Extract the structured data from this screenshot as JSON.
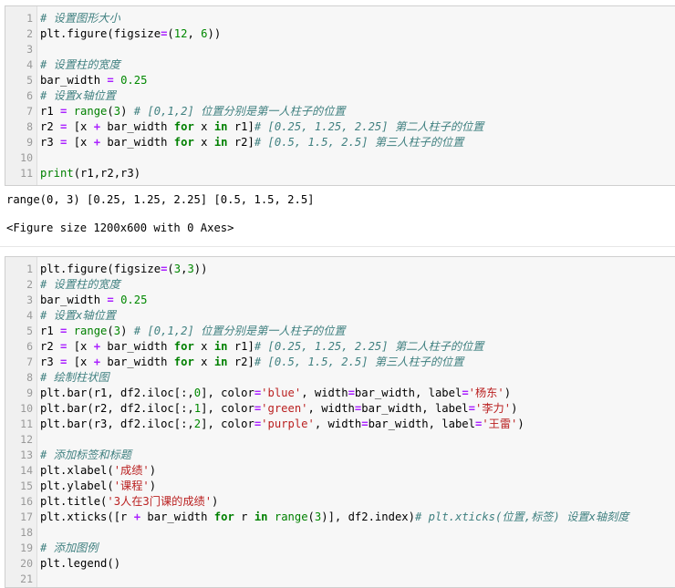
{
  "cell1": {
    "lines": [
      {
        "n": "1",
        "tokens": [
          {
            "t": "# 设置图形大小",
            "c": "cm"
          }
        ]
      },
      {
        "n": "2",
        "tokens": [
          {
            "t": "plt.figure(figsize"
          },
          {
            "t": "=",
            "c": "op"
          },
          {
            "t": "("
          },
          {
            "t": "12",
            "c": "nm"
          },
          {
            "t": ", "
          },
          {
            "t": "6",
            "c": "nm"
          },
          {
            "t": "))"
          }
        ]
      },
      {
        "n": "3",
        "tokens": []
      },
      {
        "n": "4",
        "tokens": [
          {
            "t": "# 设置柱的宽度",
            "c": "cm"
          }
        ]
      },
      {
        "n": "5",
        "tokens": [
          {
            "t": "bar_width "
          },
          {
            "t": "=",
            "c": "op"
          },
          {
            "t": " "
          },
          {
            "t": "0.25",
            "c": "nm"
          }
        ]
      },
      {
        "n": "6",
        "tokens": [
          {
            "t": "# 设置x轴位置",
            "c": "cm"
          }
        ]
      },
      {
        "n": "7",
        "tokens": [
          {
            "t": "r1 "
          },
          {
            "t": "=",
            "c": "op"
          },
          {
            "t": " "
          },
          {
            "t": "range",
            "c": "bi"
          },
          {
            "t": "("
          },
          {
            "t": "3",
            "c": "nm"
          },
          {
            "t": ") "
          },
          {
            "t": "# [0,1,2] 位置分别是第一人柱子的位置",
            "c": "cm"
          }
        ]
      },
      {
        "n": "8",
        "tokens": [
          {
            "t": "r2 "
          },
          {
            "t": "=",
            "c": "op"
          },
          {
            "t": " [x "
          },
          {
            "t": "+",
            "c": "op"
          },
          {
            "t": " bar_width "
          },
          {
            "t": "for",
            "c": "kw"
          },
          {
            "t": " x "
          },
          {
            "t": "in",
            "c": "kw"
          },
          {
            "t": " r1]"
          },
          {
            "t": "# [0.25, 1.25, 2.25] 第二人柱子的位置",
            "c": "cm"
          }
        ]
      },
      {
        "n": "9",
        "tokens": [
          {
            "t": "r3 "
          },
          {
            "t": "=",
            "c": "op"
          },
          {
            "t": " [x "
          },
          {
            "t": "+",
            "c": "op"
          },
          {
            "t": " bar_width "
          },
          {
            "t": "for",
            "c": "kw"
          },
          {
            "t": " x "
          },
          {
            "t": "in",
            "c": "kw"
          },
          {
            "t": " r2]"
          },
          {
            "t": "# [0.5, 1.5, 2.5] 第三人柱子的位置",
            "c": "cm"
          }
        ]
      },
      {
        "n": "10",
        "tokens": []
      },
      {
        "n": "11",
        "tokens": [
          {
            "t": "print",
            "c": "bi"
          },
          {
            "t": "(r1,r2,r3)"
          }
        ]
      }
    ]
  },
  "output1": {
    "stdout": "range(0, 3) [0.25, 1.25, 2.25] [0.5, 1.5, 2.5]",
    "result": "<Figure size 1200x600 with 0 Axes>"
  },
  "cell2": {
    "lines": [
      {
        "n": "1",
        "tokens": [
          {
            "t": "plt.figure(figsize"
          },
          {
            "t": "=",
            "c": "op"
          },
          {
            "t": "("
          },
          {
            "t": "3",
            "c": "nm"
          },
          {
            "t": ","
          },
          {
            "t": "3",
            "c": "nm"
          },
          {
            "t": "))"
          }
        ]
      },
      {
        "n": "2",
        "tokens": [
          {
            "t": "# 设置柱的宽度",
            "c": "cm"
          }
        ]
      },
      {
        "n": "3",
        "tokens": [
          {
            "t": "bar_width "
          },
          {
            "t": "=",
            "c": "op"
          },
          {
            "t": " "
          },
          {
            "t": "0.25",
            "c": "nm"
          }
        ]
      },
      {
        "n": "4",
        "tokens": [
          {
            "t": "# 设置x轴位置",
            "c": "cm"
          }
        ]
      },
      {
        "n": "5",
        "tokens": [
          {
            "t": "r1 "
          },
          {
            "t": "=",
            "c": "op"
          },
          {
            "t": " "
          },
          {
            "t": "range",
            "c": "bi"
          },
          {
            "t": "("
          },
          {
            "t": "3",
            "c": "nm"
          },
          {
            "t": ") "
          },
          {
            "t": "# [0,1,2] 位置分别是第一人柱子的位置",
            "c": "cm"
          }
        ]
      },
      {
        "n": "6",
        "tokens": [
          {
            "t": "r2 "
          },
          {
            "t": "=",
            "c": "op"
          },
          {
            "t": " [x "
          },
          {
            "t": "+",
            "c": "op"
          },
          {
            "t": " bar_width "
          },
          {
            "t": "for",
            "c": "kw"
          },
          {
            "t": " x "
          },
          {
            "t": "in",
            "c": "kw"
          },
          {
            "t": " r1]"
          },
          {
            "t": "# [0.25, 1.25, 2.25] 第二人柱子的位置",
            "c": "cm"
          }
        ]
      },
      {
        "n": "7",
        "tokens": [
          {
            "t": "r3 "
          },
          {
            "t": "=",
            "c": "op"
          },
          {
            "t": " [x "
          },
          {
            "t": "+",
            "c": "op"
          },
          {
            "t": " bar_width "
          },
          {
            "t": "for",
            "c": "kw"
          },
          {
            "t": " x "
          },
          {
            "t": "in",
            "c": "kw"
          },
          {
            "t": " r2]"
          },
          {
            "t": "# [0.5, 1.5, 2.5] 第三人柱子的位置",
            "c": "cm"
          }
        ]
      },
      {
        "n": "8",
        "tokens": [
          {
            "t": "# 绘制柱状图",
            "c": "cm"
          }
        ]
      },
      {
        "n": "9",
        "tokens": [
          {
            "t": "plt.bar(r1, df2.iloc[:,"
          },
          {
            "t": "0",
            "c": "nm"
          },
          {
            "t": "], color"
          },
          {
            "t": "=",
            "c": "op"
          },
          {
            "t": "'blue'",
            "c": "st"
          },
          {
            "t": ", width"
          },
          {
            "t": "=",
            "c": "op"
          },
          {
            "t": "bar_width, label"
          },
          {
            "t": "=",
            "c": "op"
          },
          {
            "t": "'杨东'",
            "c": "st"
          },
          {
            "t": ")"
          }
        ]
      },
      {
        "n": "10",
        "tokens": [
          {
            "t": "plt.bar(r2, df2.iloc[:,"
          },
          {
            "t": "1",
            "c": "nm"
          },
          {
            "t": "], color"
          },
          {
            "t": "=",
            "c": "op"
          },
          {
            "t": "'green'",
            "c": "st"
          },
          {
            "t": ", width"
          },
          {
            "t": "=",
            "c": "op"
          },
          {
            "t": "bar_width, label"
          },
          {
            "t": "=",
            "c": "op"
          },
          {
            "t": "'李力'",
            "c": "st"
          },
          {
            "t": ")"
          }
        ]
      },
      {
        "n": "11",
        "tokens": [
          {
            "t": "plt.bar(r3, df2.iloc[:,"
          },
          {
            "t": "2",
            "c": "nm"
          },
          {
            "t": "], color"
          },
          {
            "t": "=",
            "c": "op"
          },
          {
            "t": "'purple'",
            "c": "st"
          },
          {
            "t": ", width"
          },
          {
            "t": "=",
            "c": "op"
          },
          {
            "t": "bar_width, label"
          },
          {
            "t": "=",
            "c": "op"
          },
          {
            "t": "'王雷'",
            "c": "st"
          },
          {
            "t": ")"
          }
        ]
      },
      {
        "n": "12",
        "tokens": []
      },
      {
        "n": "13",
        "tokens": [
          {
            "t": "# 添加标签和标题",
            "c": "cm"
          }
        ]
      },
      {
        "n": "14",
        "tokens": [
          {
            "t": "plt.xlabel("
          },
          {
            "t": "'成绩'",
            "c": "st"
          },
          {
            "t": ")"
          }
        ]
      },
      {
        "n": "15",
        "tokens": [
          {
            "t": "plt.ylabel("
          },
          {
            "t": "'课程'",
            "c": "st"
          },
          {
            "t": ")"
          }
        ]
      },
      {
        "n": "16",
        "tokens": [
          {
            "t": "plt.title("
          },
          {
            "t": "'3人在3门课的成绩'",
            "c": "st"
          },
          {
            "t": ")"
          }
        ]
      },
      {
        "n": "17",
        "tokens": [
          {
            "t": "plt.xticks([r "
          },
          {
            "t": "+",
            "c": "op"
          },
          {
            "t": " bar_width "
          },
          {
            "t": "for",
            "c": "kw"
          },
          {
            "t": " r "
          },
          {
            "t": "in",
            "c": "kw"
          },
          {
            "t": " "
          },
          {
            "t": "range",
            "c": "bi"
          },
          {
            "t": "("
          },
          {
            "t": "3",
            "c": "nm"
          },
          {
            "t": ")], df2.index)"
          },
          {
            "t": "# plt.xticks(位置,标签) 设置x轴刻度",
            "c": "cm"
          }
        ]
      },
      {
        "n": "18",
        "tokens": []
      },
      {
        "n": "19",
        "tokens": [
          {
            "t": "# 添加图例",
            "c": "cm"
          }
        ]
      },
      {
        "n": "20",
        "tokens": [
          {
            "t": "plt.legend()"
          }
        ]
      },
      {
        "n": "21",
        "tokens": []
      }
    ]
  },
  "colors": {
    "comment": "#408080",
    "keyword": "#008000",
    "number": "#008800",
    "operator": "#aa22ff",
    "string": "#ba2121",
    "cell_bg": "#f7f7f7",
    "cell_border": "#cfcfcf"
  }
}
